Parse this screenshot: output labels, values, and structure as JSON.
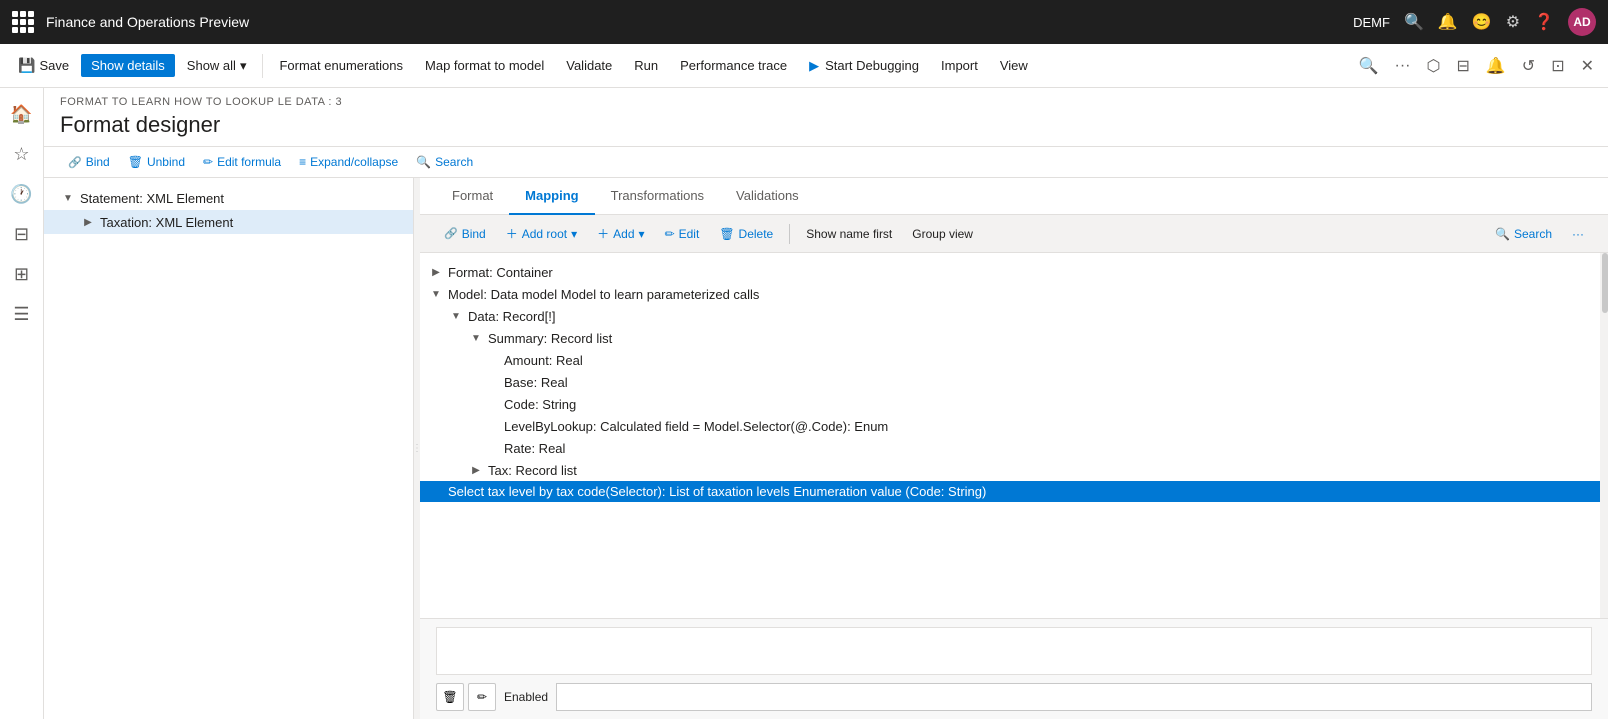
{
  "app": {
    "title": "Finance and Operations Preview",
    "user_label": "DEMF",
    "avatar": "AD"
  },
  "ribbon": {
    "save_label": "Save",
    "show_details_label": "Show details",
    "show_all_label": "Show all",
    "format_enumerations_label": "Format enumerations",
    "map_format_label": "Map format to model",
    "validate_label": "Validate",
    "run_label": "Run",
    "performance_trace_label": "Performance trace",
    "start_debugging_label": "Start Debugging",
    "import_label": "Import",
    "view_label": "View"
  },
  "page": {
    "subtitle": "FORMAT TO LEARN HOW TO LOOKUP LE DATA : 3",
    "title": "Format designer"
  },
  "format_toolbar": {
    "bind_label": "Bind",
    "unbind_label": "Unbind",
    "edit_formula_label": "Edit formula",
    "expand_collapse_label": "Expand/collapse",
    "search_label": "Search"
  },
  "tabs": {
    "format_label": "Format",
    "mapping_label": "Mapping",
    "transformations_label": "Transformations",
    "validations_label": "Validations"
  },
  "right_toolbar": {
    "bind_label": "Bind",
    "add_root_label": "Add root",
    "add_label": "Add",
    "edit_label": "Edit",
    "delete_label": "Delete",
    "show_name_first_label": "Show name first",
    "group_view_label": "Group view",
    "search_label": "Search"
  },
  "tree": {
    "items": [
      {
        "label": "Statement: XML Element",
        "indent": 0,
        "toggle": "▼",
        "expanded": true
      },
      {
        "label": "Taxation: XML Element",
        "indent": 1,
        "toggle": "▶",
        "expanded": false,
        "selected": true
      }
    ]
  },
  "model_tree": {
    "items": [
      {
        "label": "Format: Container",
        "indent": 0,
        "toggle": "▶",
        "level": 0
      },
      {
        "label": "Model: Data model Model to learn parameterized calls",
        "indent": 0,
        "toggle": "▼",
        "level": 0
      },
      {
        "label": "Data: Record[!]",
        "indent": 1,
        "toggle": "▼",
        "level": 1
      },
      {
        "label": "Summary: Record list",
        "indent": 2,
        "toggle": "▼",
        "level": 2
      },
      {
        "label": "Amount: Real",
        "indent": 3,
        "toggle": "",
        "level": 3
      },
      {
        "label": "Base: Real",
        "indent": 3,
        "toggle": "",
        "level": 3
      },
      {
        "label": "Code: String",
        "indent": 3,
        "toggle": "",
        "level": 3
      },
      {
        "label": "LevelByLookup: Calculated field = Model.Selector(@.Code): Enum",
        "indent": 3,
        "toggle": "",
        "level": 3
      },
      {
        "label": "Rate: Real",
        "indent": 3,
        "toggle": "",
        "level": 3
      },
      {
        "label": "Tax: Record list",
        "indent": 2,
        "toggle": "▶",
        "level": 2
      }
    ]
  },
  "selected_formula": {
    "text": "Select tax level by tax code(Selector): List of taxation levels Enumeration value (Code: String)"
  },
  "bottom": {
    "formula_value": "",
    "enabled_label": "Enabled",
    "enabled_value": ""
  },
  "colors": {
    "accent": "#0078d4",
    "selected_bg": "#deecf9",
    "highlighted_bg": "#0078d4",
    "highlighted_text": "#ffffff"
  }
}
